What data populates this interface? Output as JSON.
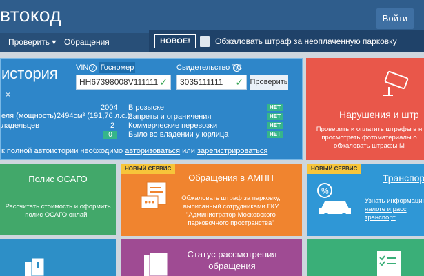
{
  "header": {
    "logo": "втокод",
    "login_label": "Войти"
  },
  "nav": {
    "check_label": "Проверить ▾",
    "requests_label": "Обращения"
  },
  "ticker": {
    "new_label": "НОВОЕ!",
    "icon": "document-icon",
    "text": "Обжаловать штраф за неоплаченную парковку"
  },
  "history": {
    "title": "история",
    "close_glyph": "×",
    "vin_label": "VIN",
    "gos_label": "Госномер",
    "vin_value": "HH67398008V111111",
    "sts_label": "Свидетельство ТС",
    "sts_value": "3035111111",
    "check_button": "Проверить",
    "specs": [
      {
        "label": "",
        "value": "2004"
      },
      {
        "label": "еля (мощность)",
        "value": "2494см³ (191,76 л.с.)"
      },
      {
        "label": "ладельцев",
        "value": "2"
      },
      {
        "label": "",
        "value": "0"
      }
    ],
    "checks": [
      {
        "label": "В розыске",
        "status": "НЕТ"
      },
      {
        "label": "Запреты и ограничения",
        "status": "НЕТ"
      },
      {
        "label": "Коммерческие перевозки",
        "status": "НЕТ"
      },
      {
        "label": "Было во владении у юрлица",
        "status": "НЕТ"
      }
    ],
    "footer_prefix": "к полной автоистории необходимо",
    "footer_login": "авторизоваться",
    "footer_or": "или",
    "footer_register": "зарегистрироваться"
  },
  "tiles": {
    "violations": {
      "title": "Нарушения и штр",
      "desc": "Проверить и оплатить штрафы в н\nпросмотреть фотоматериалы о\nобжаловать штрафы М"
    },
    "osago": {
      "title": "Полис ОСАГО",
      "desc": "Рассчитать стоимость и оформить\nполис ОСАГО онлайн"
    },
    "ampp": {
      "ribbon": "НОВЫЙ СЕРВИС",
      "title": "Обращения в АМПП",
      "desc": "Обжаловать штраф за парковку,\nвыписанный сотрудниками ГКУ\n\"Администратор Московского\nпарковочного пространства\""
    },
    "transport": {
      "ribbon": "НОВЫЙ СЕРВИС",
      "title": "Транспорт",
      "desc": "Узнать информацию\nналоге и расс\nтранспорт"
    },
    "status": {
      "title": "Статус рассмотрения\nобращения"
    }
  },
  "colors": {
    "header": "#2f5d8c",
    "history": "#2e86c9",
    "violations": "#e9574a",
    "osago": "#42a86a",
    "ampp": "#f0842f",
    "transport": "#2f97d6",
    "status": "#9f4b93",
    "badge": "#36b58a",
    "ribbon": "#f7c53a"
  }
}
